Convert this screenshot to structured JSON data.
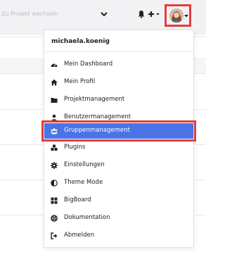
{
  "topbar": {
    "project_placeholder": "Zu Projekt wechseln"
  },
  "user_menu": {
    "username": "michaela.koenig",
    "items": [
      {
        "label": "Mein Dashboard",
        "icon": "dashboard-icon"
      },
      {
        "label": "Mein Profil",
        "icon": "home-icon"
      },
      {
        "label": "Projektmanagement",
        "icon": "folder-icon"
      },
      {
        "label": "Benutzermanagement",
        "icon": "user-icon"
      },
      {
        "label": "Gruppenmanagement",
        "icon": "users-icon",
        "active": true
      },
      {
        "label": "Plugins",
        "icon": "cubes-icon"
      },
      {
        "label": "Einstellungen",
        "icon": "gear-icon"
      },
      {
        "label": "Theme Mode",
        "icon": "half-circle-icon"
      },
      {
        "label": "BigBoard",
        "icon": "grid-icon"
      },
      {
        "label": "Dokumentation",
        "icon": "lifebuoy-icon"
      },
      {
        "label": "Abmelden",
        "icon": "sign-out-icon"
      }
    ]
  },
  "colors": {
    "active_bg": "#4a73e5",
    "highlight_border": "#e53d3d",
    "topbar_bg": "#f2f2f4"
  }
}
